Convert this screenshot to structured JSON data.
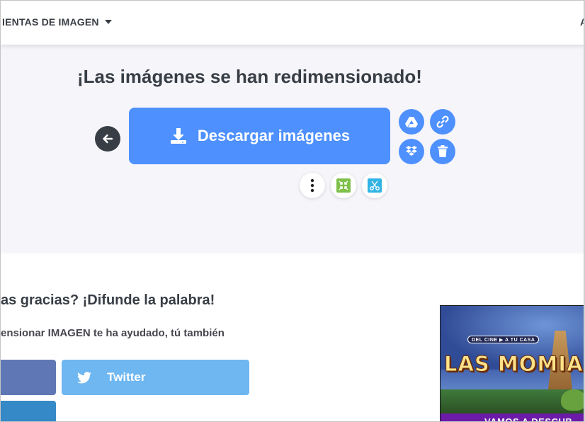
{
  "header": {
    "menu_label": "IENTAS DE IMAGEN",
    "right_label": "A"
  },
  "hero": {
    "title": "¡Las imágenes se han redimensionado!",
    "download_label": "Descargar imágenes"
  },
  "icons": {
    "back": "arrow-left-icon",
    "download": "download-icon",
    "google_drive": "google-drive-icon",
    "link": "link-icon",
    "dropbox": "dropbox-icon",
    "delete": "trash-icon",
    "more": "more-vertical-icon",
    "compress": "compress-icon",
    "crop": "scissors-icon",
    "twitter": "twitter-icon"
  },
  "share": {
    "title": "as gracias? ¡Difunde la palabra!",
    "subtitle": "ensionar IMAGEN te ha ayudado, tú también",
    "twitter_label": "Twitter"
  },
  "ad": {
    "badge": "DEL CINE ▶ A TU CASA",
    "title": "LAS MOMIAS",
    "bottom_text": "VAMOS A DESCUB"
  },
  "colors": {
    "primary": "#4d90fe",
    "dark": "#383e45",
    "hero_bg": "#f5f5fa",
    "facebook": "#5f78b5",
    "twitter": "#6fb7f1",
    "linkedin": "#3589c6"
  }
}
